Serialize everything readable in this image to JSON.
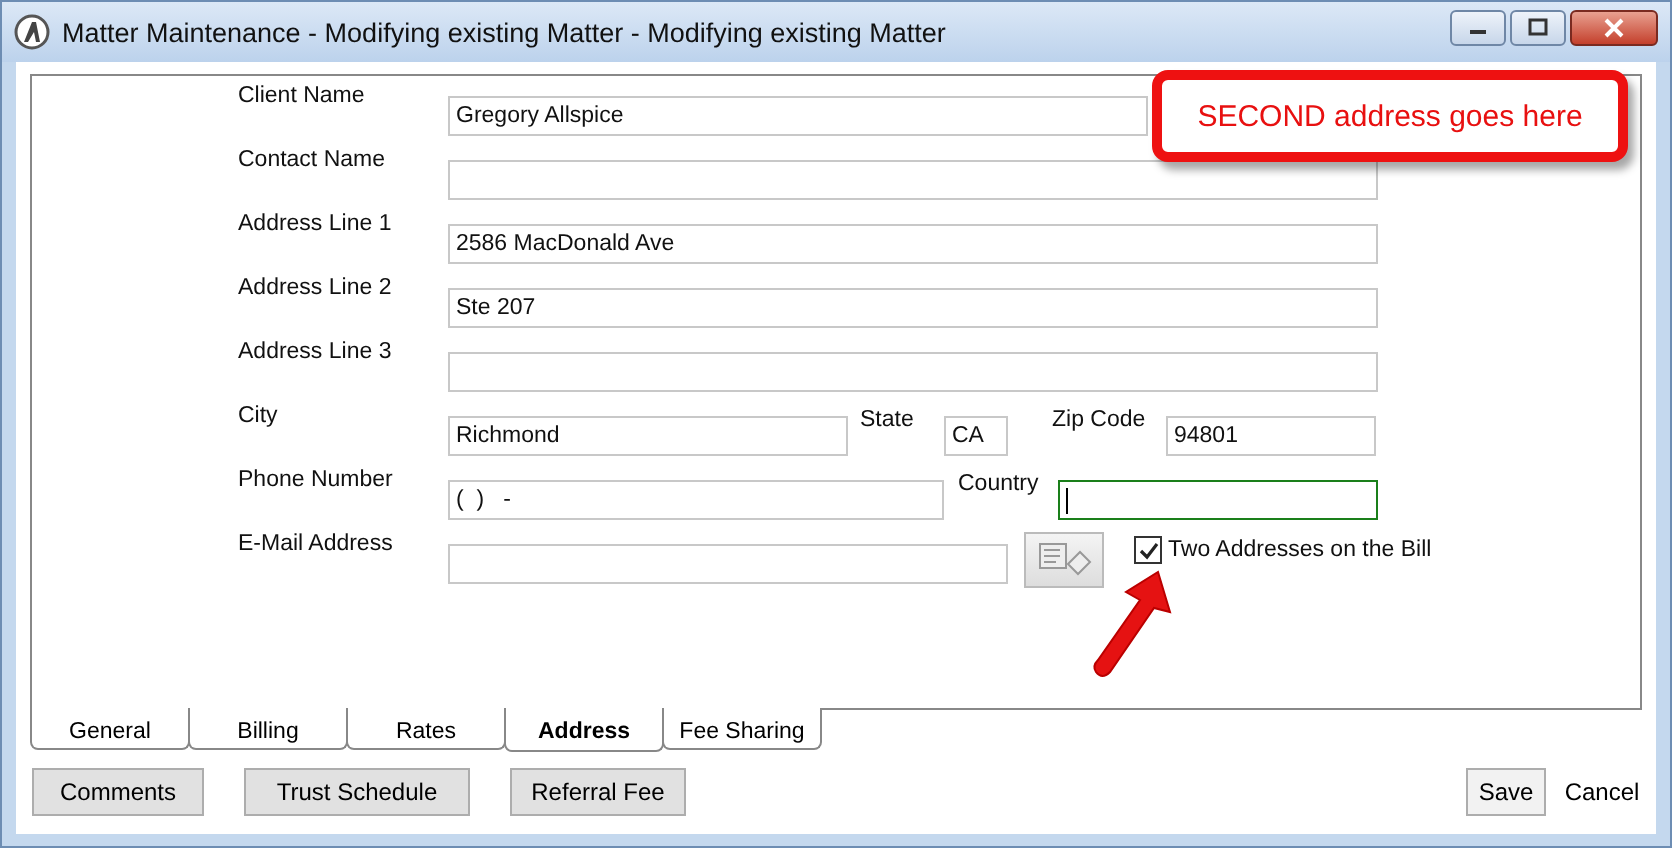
{
  "window": {
    "title": "Matter Maintenance - Modifying existing Matter - Modifying existing Matter"
  },
  "fields": [
    {
      "label": "Client Name",
      "value": "Gregory Allspice"
    },
    {
      "label": "Contact Name"
    },
    {
      "label": "Address Line 1",
      "value": "2586 MacDonald Ave"
    },
    {
      "label": "Address Line 2",
      "value": "Ste 207"
    },
    {
      "label": "Address Line 3"
    }
  ],
  "city": {
    "label": "City",
    "value": "Richmond"
  },
  "state": {
    "label": "State",
    "value": "CA"
  },
  "zip": {
    "label": "Zip Code",
    "value": "94801"
  },
  "phone": {
    "label": "Phone Number",
    "value": "(  )   -"
  },
  "country": {
    "label": "Country",
    "focused": true
  },
  "email": {
    "label": "E-Mail Address"
  },
  "two_addresses": {
    "label": "Two Addresses on the Bill",
    "checked": true
  },
  "callout": {
    "text": "SECOND address goes here"
  },
  "tabs": [
    {
      "label": "General",
      "selected": false
    },
    {
      "label": "Billing",
      "selected": false
    },
    {
      "label": "Rates",
      "selected": false
    },
    {
      "label": "Address",
      "selected": true
    },
    {
      "label": "Fee Sharing",
      "selected": false
    }
  ],
  "buttons": [
    {
      "label": "Comments",
      "kind": "push"
    },
    {
      "label": "Trust Schedule",
      "kind": "push"
    },
    {
      "label": "Referral Fee",
      "kind": "push"
    },
    {
      "label": "Save",
      "kind": "default"
    },
    {
      "label": "Cancel",
      "kind": "flat"
    }
  ]
}
